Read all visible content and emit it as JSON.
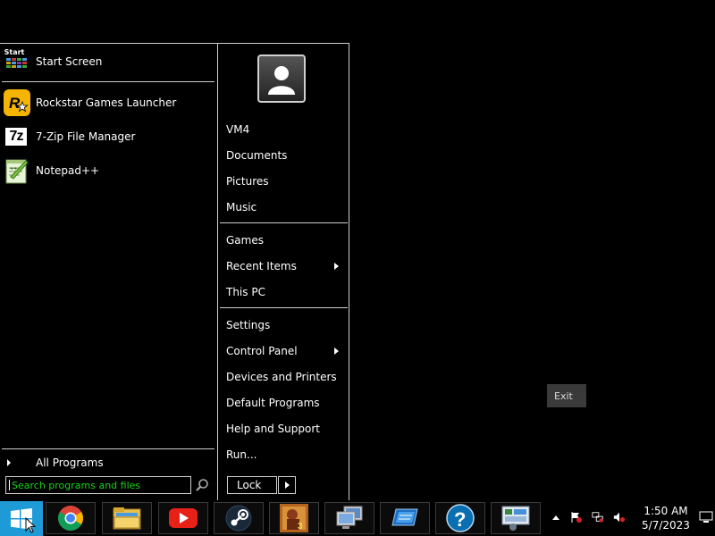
{
  "start_menu": {
    "start_screen": {
      "icon_text": "Start",
      "label": "Start Screen"
    },
    "programs": [
      {
        "label": "Rockstar Games Launcher",
        "icon": "rockstar-icon"
      },
      {
        "label": "7-Zip File Manager",
        "icon": "7zip-icon",
        "icon_text": "7z"
      },
      {
        "label": "Notepad++",
        "icon": "notepad-plus-plus-icon"
      }
    ],
    "all_programs": "All Programs",
    "search_placeholder": "Search programs and files",
    "right": {
      "user_name": "VM4",
      "items_group1": [
        "Documents",
        "Pictures",
        "Music"
      ],
      "items_group2": [
        "Games",
        "Recent Items",
        "This PC"
      ],
      "items_group3": [
        "Settings",
        "Control Panel",
        "Devices and Printers",
        "Default Programs",
        "Help and Support",
        "Run..."
      ]
    },
    "lock_label": "Lock"
  },
  "desktop": {
    "exit_label": "Exit"
  },
  "taskbar": {
    "pinned": [
      "chrome-icon",
      "file-explorer-icon",
      "youtube-icon",
      "steam-icon",
      "game-app-icon",
      "remote-desktop-icon",
      "pc-app-icon",
      "help-icon",
      "control-panel-icon"
    ],
    "clock": {
      "time": "1:50 AM",
      "date": "5/7/2023"
    },
    "colors": {
      "start_button": "#1e9bd7",
      "youtube": "#e62117",
      "help": "#0a6fb0",
      "search_text": "#19d419"
    }
  }
}
